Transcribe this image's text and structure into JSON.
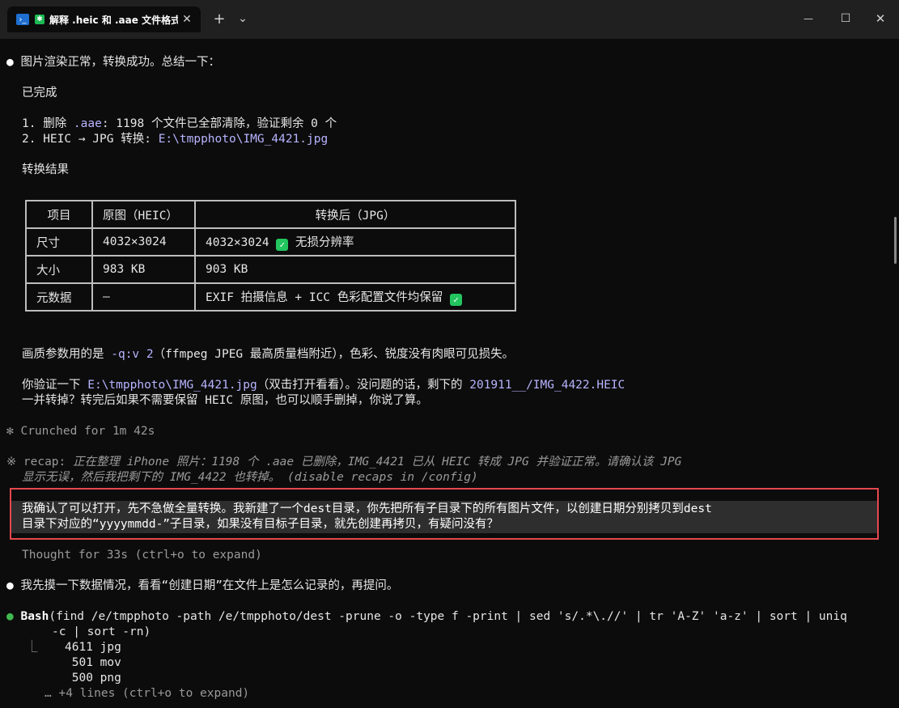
{
  "window": {
    "tab_title": "解释 .heic 和 .aae 文件格式",
    "tab_close": "✕",
    "new_tab": "+",
    "dropdown": "⌄",
    "minimize": "—",
    "maximize": "☐",
    "close": "✕"
  },
  "lines": {
    "l1": "图片渲染正常，转换成功。总结一下：",
    "done": "已完成",
    "item1_a": "1. 删除 ",
    "item1_b": ".aae",
    "item1_c": ": 1198 个文件已全部清除，验证剩余 0 个",
    "item2_a": "2. HEIC → JPG 转换: ",
    "item2_b": "E:\\tmpphoto\\IMG_4421.jpg",
    "result": "转换结果",
    "quality_a": "画质参数用的是 ",
    "quality_b": "-q:v 2",
    "quality_c": "（ffmpeg JPEG 最高质量档附近），色彩、锐度没有肉眼可见损失。",
    "verify_a": "你验证一下 ",
    "verify_b": "E:\\tmpphoto\\IMG_4421.jpg",
    "verify_c": "（双击打开看看）。没问题的话，剩下的 ",
    "verify_d": "201911__/IMG_4422.HEIC",
    "verify2": "一并转掉？转完后如果不需要保留 HEIC 原图，也可以顺手删掉，你说了算。",
    "crunched_icon": "✻",
    "crunched": "Crunched for 1m 42s",
    "recap_icon": "※",
    "recap_label": "recap:",
    "recap_1": " 正在整理 iPhone 照片：1198 个 .aae 已删除，IMG_4421 已从 HEIC 转成 JPG 并验证正常。请确认该 JPG",
    "recap_2": "显示无误，然后我把剩下的 IMG_4422 也转掉。",
    "recap_3": "(disable recaps in /config)",
    "user_1": "我确认了可以打开，先不急做全量转换。我新建了一个dest目录，你先把所有子目录下的所有图片文件，以创建日期分别拷贝到dest",
    "user_2": "目录下对应的“yyyymmdd-”子目录，如果没有目标子目录，就先创建再拷贝，有疑问没有？",
    "thought": "Thought for 33s (ctrl+o to expand)",
    "probe": "我先摸一下数据情况，看看“创建日期”在文件上是怎么记录的，再提问。",
    "bash_label": "Bash",
    "bash_1": "(find /e/tmpphoto -path /e/tmpphoto/dest -prune -o -type f -print | sed 's/.*\\.//' | tr 'A-Z' 'a-z' | sort | uniq",
    "bash_2": "-c | sort -rn)",
    "out_corner": "⎿",
    "out_1": "4611 jpg",
    "out_2": " 501 mov",
    "out_3": " 500 png",
    "more": "… +4 lines (ctrl+o to expand)",
    "bullet": "●"
  },
  "table": {
    "headers": [
      "项目",
      "原图（HEIC）",
      "转换后（JPG）"
    ],
    "rows": [
      [
        "尺寸",
        "4032×3024",
        "4032×3024",
        "无损分辨率"
      ],
      [
        "大小",
        "983 KB",
        "903 KB",
        ""
      ],
      [
        "元数据",
        "–",
        "EXIF 拍摄信息 + ICC 色彩配置文件均保留",
        ""
      ]
    ],
    "check": "✓"
  },
  "colors": {
    "background": "#0c0c0c",
    "link": "#b7b4ff",
    "success_bullet": "#3fb950",
    "highlight_border": "#e5484d"
  }
}
